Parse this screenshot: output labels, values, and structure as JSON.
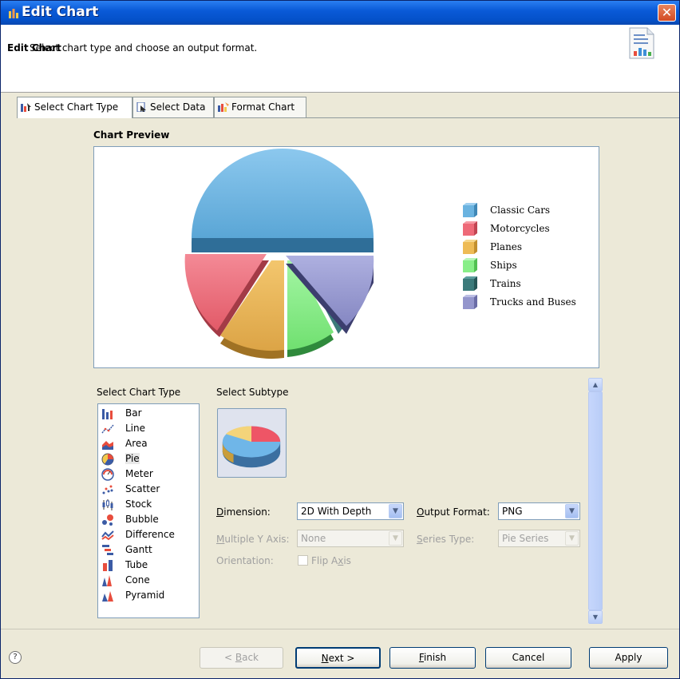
{
  "window": {
    "title": "Edit Chart",
    "close_glyph": "✕"
  },
  "header": {
    "title": "Edit Chart",
    "description": "Select chart type and choose an output format."
  },
  "tabs": [
    {
      "label": "Select Chart Type",
      "icon": "chart-type-icon",
      "active": true
    },
    {
      "label": "Select Data",
      "icon": "data-icon",
      "active": false
    },
    {
      "label": "Format Chart",
      "icon": "format-chart-icon",
      "active": false
    }
  ],
  "preview": {
    "title": "Chart Preview",
    "legend": [
      {
        "label": "Classic Cars",
        "color": "#6ab3e0"
      },
      {
        "label": "Motorcycles",
        "color": "#ee6a78"
      },
      {
        "label": "Planes",
        "color": "#eebb55"
      },
      {
        "label": "Ships",
        "color": "#88ee88"
      },
      {
        "label": "Trains",
        "color": "#3b7a7a"
      },
      {
        "label": "Trucks and Buses",
        "color": "#9496cc"
      }
    ]
  },
  "chart_type": {
    "label": "Select Chart Type",
    "items": [
      "Bar",
      "Line",
      "Area",
      "Pie",
      "Meter",
      "Scatter",
      "Stock",
      "Bubble",
      "Difference",
      "Gantt",
      "Tube",
      "Cone",
      "Pyramid"
    ],
    "selected": "Pie"
  },
  "subtype": {
    "label": "Select Subtype"
  },
  "options": {
    "dimension_label_pre": "",
    "dimension_label_u": "D",
    "dimension_label_post": "imension:",
    "dimension_value": "2D With Depth",
    "output_label_pre": "",
    "output_label_u": "O",
    "output_label_post": "utput Format:",
    "output_value": "PNG",
    "multiy_label_pre": "",
    "multiy_label_u": "M",
    "multiy_label_post": "ultiple Y Axis:",
    "multiy_value": "None",
    "series_label_pre": "",
    "series_label_u": "S",
    "series_label_post": "eries Type:",
    "series_value": "Pie Series",
    "orientation_label": "Orientation:",
    "flip_label_pre": "Flip A",
    "flip_label_u": "x",
    "flip_label_post": "is"
  },
  "buttons": {
    "help": "?",
    "back_pre": "< ",
    "back_u": "B",
    "back_post": "ack",
    "next_u": "N",
    "next_post": "ext >",
    "finish_u": "F",
    "finish_post": "inish",
    "cancel": "Cancel",
    "apply": "Apply"
  }
}
